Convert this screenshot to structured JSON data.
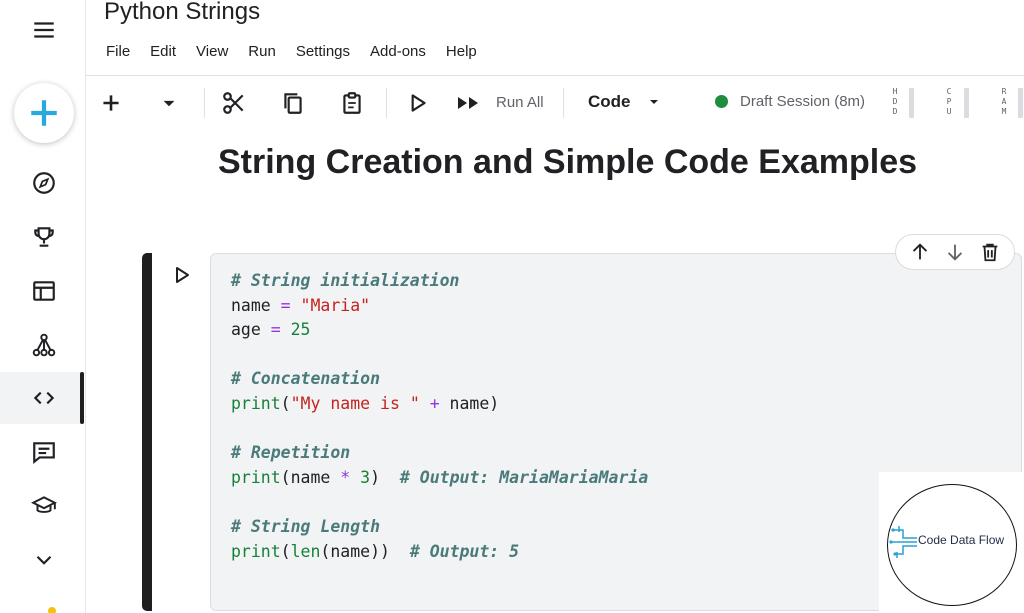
{
  "app": {
    "title": "Python Strings"
  },
  "menu": [
    "File",
    "Edit",
    "View",
    "Run",
    "Settings",
    "Add-ons",
    "Help"
  ],
  "toolbar": {
    "run_all_label": "Run All",
    "cell_type": "Code",
    "session_status": "Draft Session (8m)",
    "meters": [
      {
        "label": "H D D"
      },
      {
        "label": "C P U"
      },
      {
        "label": "R A M"
      }
    ]
  },
  "page": {
    "heading": "String Creation and Simple Code Examples"
  },
  "cell": {
    "lines": [
      "# String initialization",
      "name = \"Maria\"",
      "age = 25",
      "",
      "# Concatenation",
      "print(\"My name is \" + name)",
      "",
      "# Repetition",
      "print(name * 3)  # Output: MariaMariaMaria",
      "",
      "# String Length",
      "print(len(name))  # Output: 5"
    ]
  },
  "watermark": {
    "text": "Code Data Flow"
  },
  "colors": {
    "accent": "#29a8e0",
    "session": "#1e8e3e",
    "cell_bar": "#1f1f1f"
  },
  "icons": [
    "hamburger-icon",
    "plus-icon",
    "compass-icon",
    "trophy-icon",
    "table-icon",
    "network-icon",
    "code-icon",
    "comment-icon",
    "graduation-cap-icon",
    "chevron-down-icon"
  ]
}
